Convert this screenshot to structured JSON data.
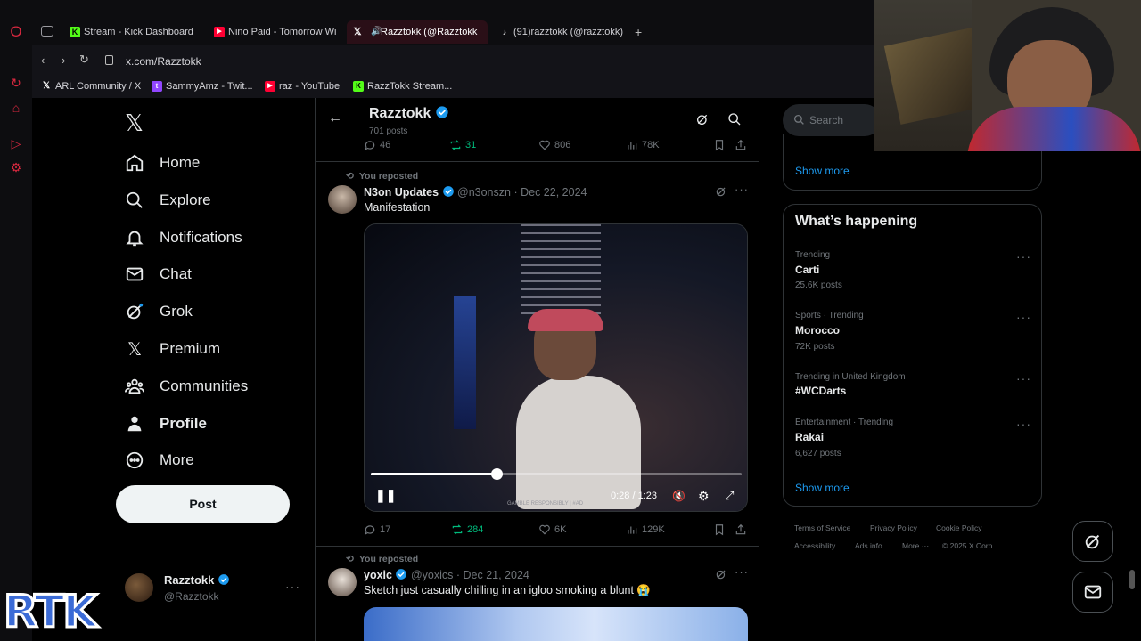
{
  "browser": {
    "tabs": [
      {
        "label": "Stream - Kick Dashboard",
        "icon": "kick-icon"
      },
      {
        "label": "Nino Paid - Tomorrow Wi",
        "icon": "youtube-icon"
      },
      {
        "label": "Razztokk (@Razztokk",
        "icon": "x-icon"
      },
      {
        "label": "(91)razztokk (@razztokk)",
        "icon": "tiktok-icon"
      }
    ],
    "url": "x.com/Razztokk",
    "bookmarks": [
      {
        "label": "ARL Community / X"
      },
      {
        "label": "SammyAmz - Twit..."
      },
      {
        "label": "raz - YouTube"
      },
      {
        "label": "RazzTokk Stream..."
      }
    ]
  },
  "nav": {
    "items": [
      "Home",
      "Explore",
      "Notifications",
      "Chat",
      "Grok",
      "Premium",
      "Communities",
      "Profile",
      "More"
    ],
    "post_label": "Post"
  },
  "account": {
    "name": "Razztokk",
    "handle": "@Razztokk"
  },
  "header": {
    "title": "Razztokk",
    "subtitle": "701 posts"
  },
  "prev_stats": {
    "replies": "46",
    "reposts": "31",
    "likes": "806",
    "views": "78K"
  },
  "tweets": [
    {
      "reposted": "You reposted",
      "name": "N3on Updates",
      "handle": "@n3onszn",
      "date": "Dec 22, 2024",
      "text": "Manifestation",
      "video_time": "0:28 / 1:23",
      "video_progress": 0.34,
      "video_caption": "GAMBLE RESPONSIBLY | #AD",
      "stats": {
        "replies": "17",
        "reposts": "284",
        "likes": "6K",
        "views": "129K"
      }
    },
    {
      "reposted": "You reposted",
      "name": "yoxic",
      "handle": "@yoxics",
      "date": "Dec 21, 2024",
      "text": "Sketch just casually chilling in an igloo smoking a blunt 😭"
    }
  ],
  "right": {
    "search_placeholder": "Search",
    "show_more_top": "Show more",
    "happening_title": "What’s happening",
    "trends": [
      {
        "context": "Trending",
        "name": "Carti",
        "count": "25.6K posts"
      },
      {
        "context": "Sports · Trending",
        "name": "Morocco",
        "count": "72K posts"
      },
      {
        "context": "Trending in United Kingdom",
        "name": "#WCDarts",
        "count": ""
      },
      {
        "context": "Entertainment · Trending",
        "name": "Rakai",
        "count": "6,627 posts"
      }
    ],
    "show_more": "Show more",
    "footer": [
      "Terms of Service",
      "Privacy Policy",
      "Cookie Policy",
      "Accessibility",
      "Ads info",
      "More ···",
      "© 2025 X Corp."
    ]
  },
  "overlay": {
    "logo_text": "RTK"
  },
  "colors": {
    "accent": "#1d9bf0",
    "repost": "#00ba7c",
    "opera": "#d8283f",
    "active_tab": "#2a0f17"
  }
}
